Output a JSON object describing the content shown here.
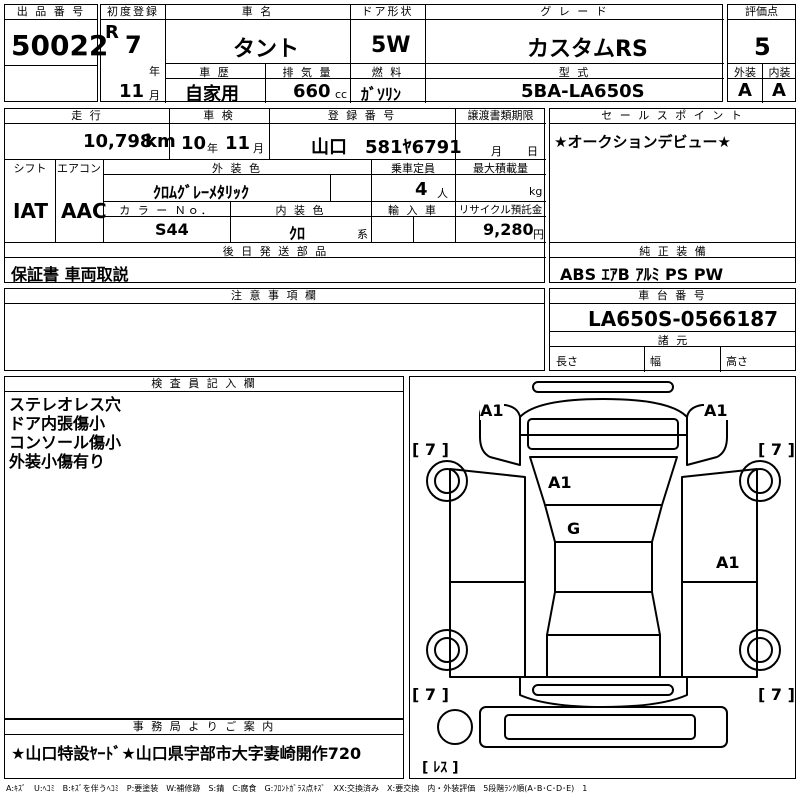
{
  "top": {
    "lot_label": "出 品 番 号",
    "lot_no": "50022",
    "first_reg_label": "初度登録",
    "era": "R",
    "year": "7",
    "year_unit": "年",
    "month": "11",
    "month_unit": "月",
    "name_label": "車 名",
    "name": "タント",
    "door_label": "ドア形状",
    "door": "5W",
    "grade_label": "グ レ ー ド",
    "grade": "カスタムRS",
    "score_label": "評価点",
    "score": "5",
    "history_label": "車 歴",
    "history": "自家用",
    "disp_label": "排 気 量",
    "disp": "660",
    "disp_unit": "cc",
    "fuel_label": "燃 料",
    "fuel": "ｶﾞｿﾘﾝ",
    "model_label": "型 式",
    "model": "5BA-LA650S",
    "ext_label": "外装",
    "ext": "A",
    "int_label": "内装",
    "int": "A"
  },
  "mid": {
    "mileage_label": "走 行",
    "mileage": "10,798",
    "mileage_unit": "km",
    "inspect_label": "車 検",
    "inspect_year": "10",
    "inspect_year_unit": "年",
    "inspect_month": "11",
    "inspect_month_unit": "月",
    "plate_label": "登 録 番 号",
    "plate": "山口　581ﾔ6791",
    "transfer_label": "譲渡書類期限",
    "transfer_month_unit": "月",
    "transfer_day_unit": "日",
    "sales_label": "セ ー ル ス ポ イ ン ト",
    "sales": "★オークションデビュー★",
    "shift_label": "シフト",
    "shift": "IAT",
    "ac_label": "エアコン",
    "ac": "AAC",
    "color_label": "外 装 色",
    "color": "ｸﾛﾑｸﾞﾚｰﾒﾀﾘｯｸ",
    "capacity_label": "乗車定員",
    "capacity": "4",
    "capacity_unit": "人",
    "load_label": "最大積載量",
    "load_unit": "kg",
    "color_no_label": "カ ラ ー Ｎｏ．",
    "color_no": "S44",
    "int_color_label": "内 装 色",
    "int_color": "ｸﾛ",
    "int_color_unit": "系",
    "import_label": "輸 入 車",
    "recycle_label": "リサイクル預託金",
    "recycle": "9,280",
    "recycle_unit": "円",
    "later_label": "後 日 発 送 部 品",
    "later": "保証書 車両取説",
    "equip_label": "純 正 装 備",
    "equip": "ABS ｴｱB ｱﾙﾐ PS PW"
  },
  "notice": {
    "label": "注 意 事 項 欄",
    "chassis_label": "車 台 番 号",
    "chassis": "LA650S-0566187",
    "dims_label": "諸 元",
    "length_label": "長さ",
    "width_label": "幅",
    "height_label": "高さ"
  },
  "inspector": {
    "label": "検 査 員 記 入 欄",
    "lines": [
      "ステレオレス穴",
      "ドア内張傷小",
      "コンソール傷小",
      "外装小傷有り"
    ]
  },
  "office": {
    "label": "事 務 局 よ り ご 案 内",
    "text": "★山口特設ﾔｰﾄﾞ★山口県宇部市大字妻崎開作720"
  },
  "diagram": {
    "marks": [
      "A1",
      "A1",
      "A1",
      "G",
      "A1"
    ],
    "tires": [
      "[ 7 ]",
      "[ 7 ]",
      "[ 7 ]",
      "[ 7 ]"
    ],
    "spare": "[ ﾚｽ ]"
  },
  "legend": "A:ｷｽﾞ　U:ﾍｺﾐ　B:ｷｽﾞを伴うﾍｺﾐ　P:要塗装　W:補修跡　S:錆　C:腐食　G:ﾌﾛﾝﾄｶﾞﾗｽ点ｷｽﾞ　XX:交換済み　X:要交換　内・外装評価　5段階ﾗﾝｸ順(A･B･C･D･E)　1"
}
